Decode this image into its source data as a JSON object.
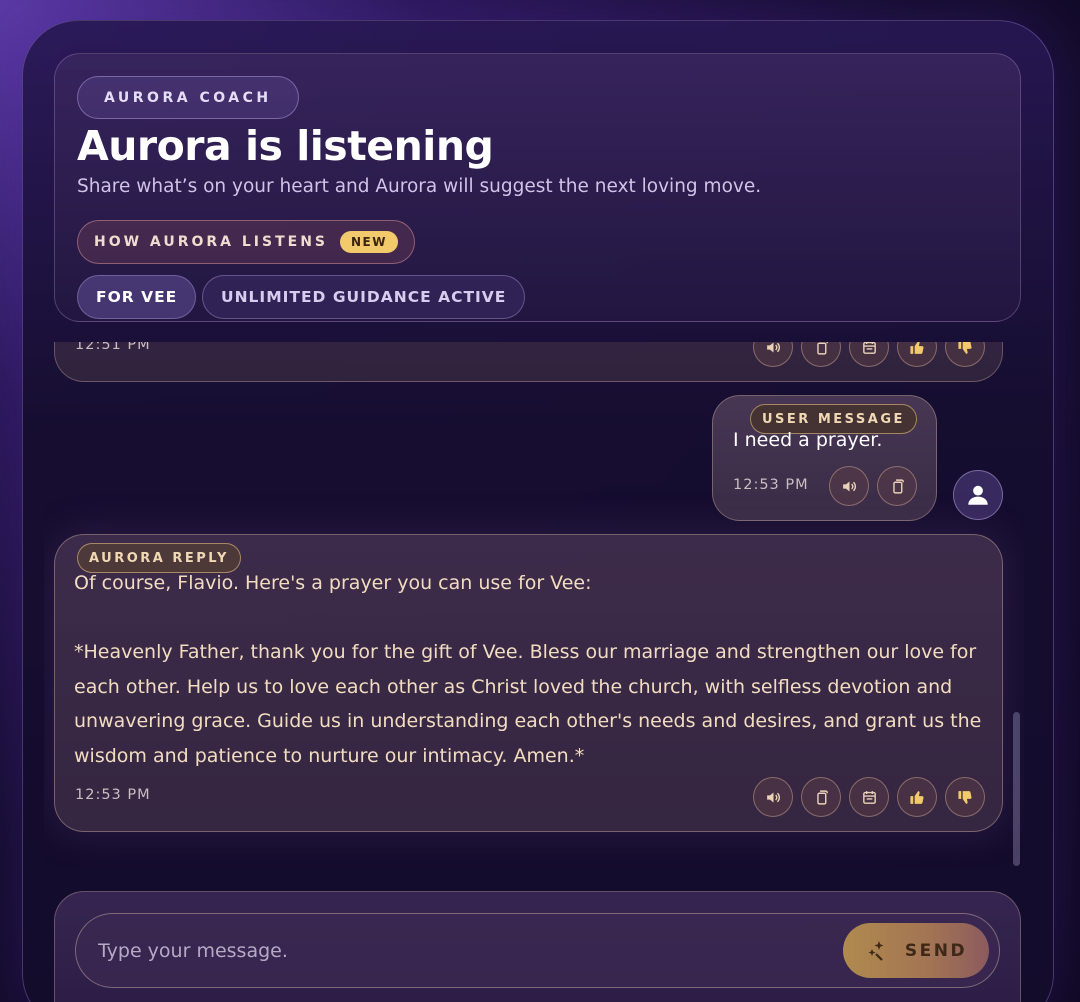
{
  "header": {
    "coach_label": "AURORA COACH",
    "title": "Aurora is listening",
    "subtitle": "Share what’s on your heart and Aurora will suggest the next loving move.",
    "listens_label": "HOW AURORA LISTENS",
    "new_badge": "NEW",
    "chips": [
      "FOR VEE",
      "UNLIMITED GUIDANCE ACTIVE"
    ]
  },
  "messages": {
    "previous": {
      "time": "12:51 PM"
    },
    "user": {
      "tag": "USER MESSAGE",
      "text": "I need a prayer.",
      "time": "12:53 PM"
    },
    "reply": {
      "tag": "AURORA REPLY",
      "lines": [
        "Of course, Flavio. Here's a prayer you can use for Vee:",
        "*Heavenly Father, thank you for the gift of Vee. Bless our marriage and strengthen our love for each other. Help us to love each other as Christ loved the church, with selfless devotion and unwavering grace. Guide us in understanding each other's needs and desires, and grant us the wisdom and patience to nurture our intimacy. Amen.*"
      ],
      "time": "12:53 PM"
    }
  },
  "action_icons": [
    "speaker-icon",
    "copy-icon",
    "calendar-icon",
    "thumbs-up-icon",
    "thumbs-down-icon"
  ],
  "composer": {
    "placeholder": "Type your message.",
    "send_label": "SEND"
  },
  "colors": {
    "accent_gold": "#f2c96b",
    "reply_text": "#f2dcc0",
    "send_gradient_start": "#b08a4e",
    "send_gradient_end": "#8c5a5e"
  }
}
